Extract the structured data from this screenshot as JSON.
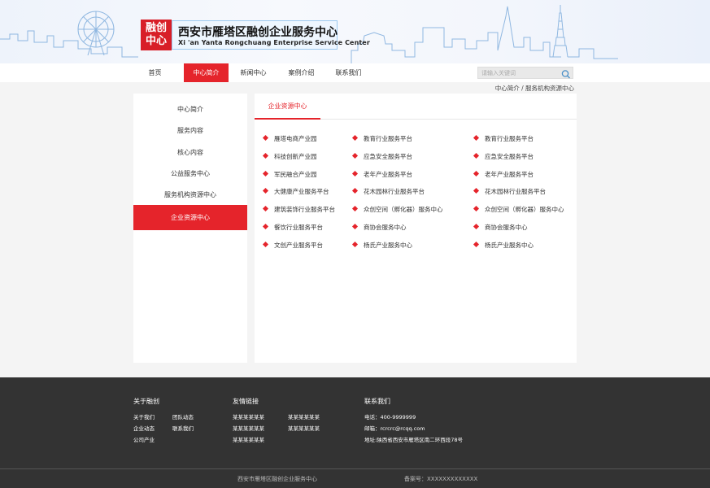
{
  "header": {
    "logo_seal": "融创\n中心",
    "title": "西安市雁塔区融创企业服务中心",
    "subtitle": "Xi 'an Yanta Rongchuang Enterprise Service Center"
  },
  "nav": {
    "items": [
      "首页",
      "中心简介",
      "新闻中心",
      "案例介绍",
      "联系我们"
    ],
    "active_index": 1,
    "search_placeholder": "请输入关键词",
    "search_icon": "search-icon"
  },
  "breadcrumb": "中心简介 / 服务机构资源中心",
  "sidebar": {
    "items": [
      "中心简介",
      "服务内容",
      "核心内容",
      "公益服务中心",
      "服务机构资源中心",
      "企业资源中心"
    ],
    "active_index": 5
  },
  "content": {
    "tab": "企业资源中心",
    "columns": [
      [
        "雁塔电商产业园",
        "科技创新产业园",
        "军民融合产业园",
        "大健康产业服务平台",
        "建筑装饰行业服务平台",
        "餐饮行业服务平台",
        "文创产业服务平台"
      ],
      [
        "教育行业服务平台",
        "应急安全服务平台",
        "老年产业服务平台",
        "花木园林行业服务平台",
        "众创空间（孵化器）服务中心",
        "商协会服务中心",
        "杨氏产业服务中心"
      ],
      [
        "教育行业服务平台",
        "应急安全服务平台",
        "老年产业服务平台",
        "花木园林行业服务平台",
        "众创空间（孵化器）服务中心",
        "商协会服务中心",
        "杨氏产业服务中心"
      ]
    ]
  },
  "footer": {
    "about": {
      "title": "关于融创",
      "links": [
        "关于我们",
        "团队动态",
        "企业动态",
        "联系我们",
        "公司产业"
      ]
    },
    "friends": {
      "title": "友情链接",
      "links": [
        "某某某某某某",
        "某某某某某某",
        "某某某某某某",
        "某某某某某某",
        "某某某某某某"
      ]
    },
    "contact": {
      "title": "联系我们",
      "phone": "电话：400-9999999",
      "email": "邮箱：rcrcrc@rcqq.com",
      "address": "地址:陕西省西安市雁塔区南二环西段78号"
    },
    "copyright": "西安市雁塔区融创企业服务中心",
    "icp": "备案号：XXXXXXXXXXXXX"
  },
  "colors": {
    "accent": "#e5242b",
    "footer_bg": "#333333",
    "page_bg": "#f4f4f4"
  }
}
